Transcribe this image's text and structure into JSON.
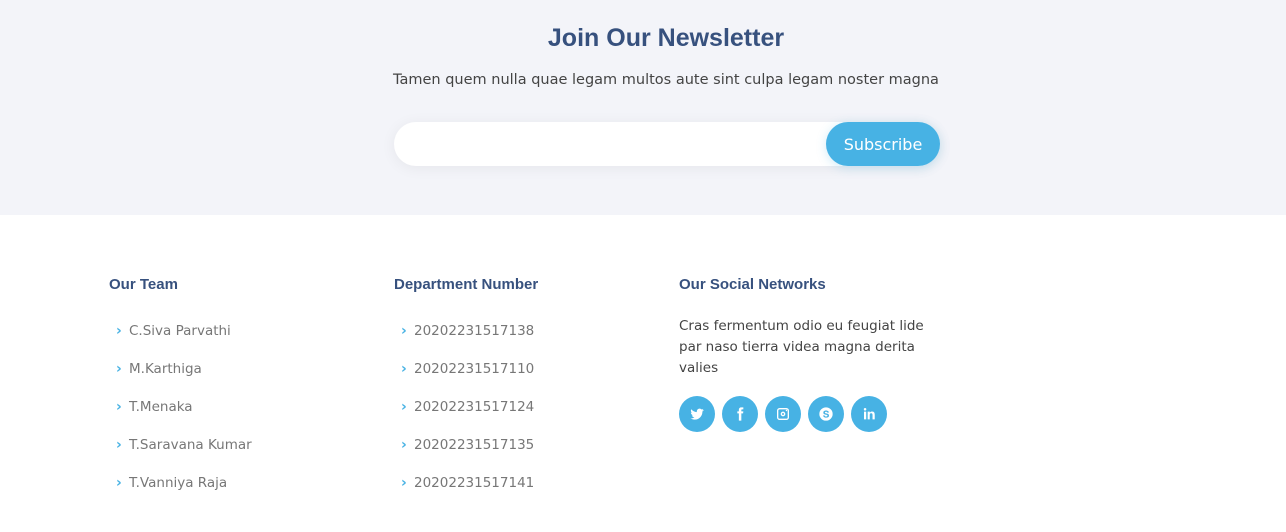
{
  "newsletter": {
    "title": "Join Our Newsletter",
    "subtitle": "Tamen quem nulla quae legam multos aute sint culpa legam noster magna",
    "input_value": "",
    "button_label": "Subscribe"
  },
  "team": {
    "title": "Our Team",
    "items": [
      {
        "label": "C.Siva Parvathi"
      },
      {
        "label": "M.Karthiga"
      },
      {
        "label": "T.Menaka"
      },
      {
        "label": "T.Saravana Kumar"
      },
      {
        "label": "T.Vanniya Raja"
      }
    ]
  },
  "department": {
    "title": "Department Number",
    "items": [
      {
        "label": "20202231517138"
      },
      {
        "label": "20202231517110"
      },
      {
        "label": "20202231517124"
      },
      {
        "label": "20202231517135"
      },
      {
        "label": "20202231517141"
      }
    ]
  },
  "social": {
    "title": "Our Social Networks",
    "description": "Cras fermentum odio eu feugiat lide par naso tierra videa magna derita valies",
    "icons": [
      "twitter-icon",
      "facebook-icon",
      "instagram-icon",
      "skype-icon",
      "linkedin-icon"
    ]
  },
  "colors": {
    "accent": "#47b2e4",
    "heading": "#37517e",
    "section_bg": "#f3f4f9"
  }
}
